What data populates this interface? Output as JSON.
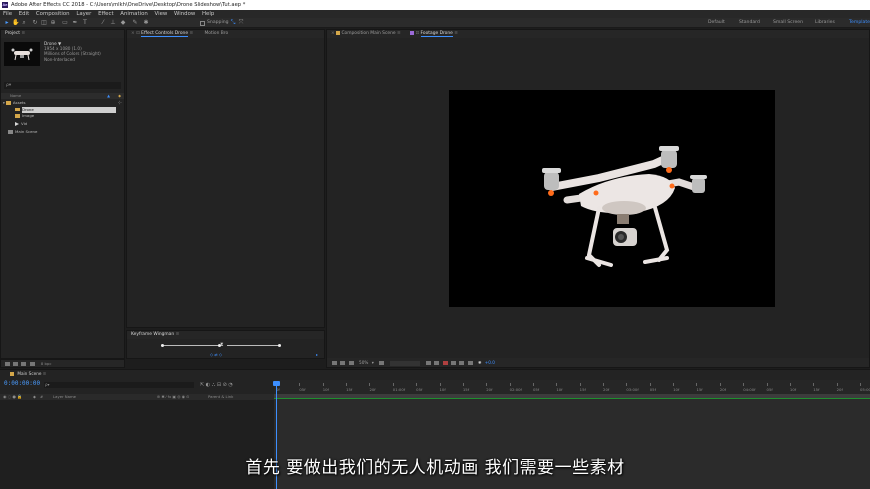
{
  "window": {
    "title": "Adobe After Effects CC 2018 - C:\\Users\\mlkh\\OneDrive\\Desktop\\Drone Slideshow\\Tut.aep *",
    "app_icon": "Ae"
  },
  "menu": [
    "File",
    "Edit",
    "Composition",
    "Layer",
    "Effect",
    "Animation",
    "View",
    "Window",
    "Help"
  ],
  "toolbar": {
    "tools": [
      "selection-tool-icon",
      "hand-tool-icon",
      "zoom-tool-icon",
      "rotate-tool-icon",
      "camera-tool-icon",
      "pan-tool-icon",
      "mask-tool-icon",
      "pen-tool-icon",
      "type-tool-icon",
      "brush-tool-icon",
      "clone-tool-icon",
      "eraser-tool-icon",
      "roto-tool-icon",
      "puppet-tool-icon"
    ],
    "snapping_label": "Snapping",
    "workspaces": [
      "Default",
      "Standard",
      "Small Screen",
      "Libraries",
      "Template"
    ],
    "active_workspace": "Template"
  },
  "project": {
    "tab": "Project",
    "selected_name": "Drone ▼",
    "selected_info": [
      "1954 x 1080 (1.0)",
      "",
      "Millions of Colors (Straight)",
      "Non-Interlaced"
    ],
    "search_placeholder": "ρ▾",
    "column_name": "Name",
    "items": [
      {
        "name": "Assets",
        "type": "folder",
        "indent": 0
      },
      {
        "name": "Drone",
        "type": "folder",
        "indent": 1,
        "selected": true
      },
      {
        "name": "Image",
        "type": "folder",
        "indent": 1
      },
      {
        "name": "Vid",
        "type": "video",
        "indent": 1
      },
      {
        "name": "Main Scene",
        "type": "comp",
        "indent": 0
      }
    ],
    "footer_bpc": "8 bpc"
  },
  "effects": {
    "tabs": [
      "Effect Controls Drone",
      "Motion Bro"
    ],
    "active_tab": "Effect Controls Drone"
  },
  "keyframe": {
    "tab": "Keyframe Wingman"
  },
  "viewer": {
    "tabs": [
      "Composition Main Scene",
      "Footage Drone"
    ],
    "active_tab": "Footage Drone",
    "zoom": "50%",
    "offset": "+0.0"
  },
  "timeline": {
    "tab": "Main Scene",
    "timecode": "0:00:00:00",
    "search_placeholder": "ρ▾",
    "col_layer_name": "Layer Name",
    "col_parent": "Parent & Link",
    "ticks": [
      "0f",
      "05f",
      "10f",
      "15f",
      "20f",
      "01:00f",
      "05f",
      "10f",
      "15f",
      "20f",
      "02:00f",
      "05f",
      "10f",
      "15f",
      "20f",
      "03:00f",
      "05f",
      "10f",
      "15f",
      "20f",
      "04:00f",
      "05f",
      "10f",
      "15f",
      "20f",
      "05:00f"
    ]
  },
  "subtitle": "首先 要做出我们的无人机动画 我们需要一些素材",
  "colors": {
    "accent": "#3d8fff",
    "folder": "#d4a74a",
    "panel": "#232323",
    "track_line": "#1f8f2f"
  }
}
